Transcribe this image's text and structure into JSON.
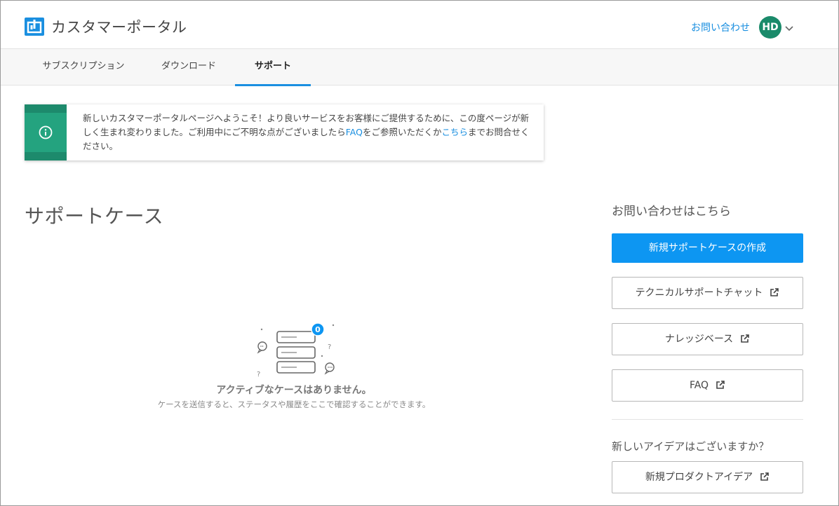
{
  "header": {
    "app_title": "カスタマーポータル",
    "contact_link": "お問い合わせ",
    "avatar_initials": "HD"
  },
  "tabs": [
    {
      "label": "サブスクリプション",
      "active": false
    },
    {
      "label": "ダウンロード",
      "active": false
    },
    {
      "label": "サポート",
      "active": true
    }
  ],
  "notice": {
    "text_before": "新しいカスタマーポータルページへようこそ！より良いサービスをお客様にご提供するために、この度ページが新しく生まれ変わりました。ご利用中にご不明な点がございましたら",
    "faq_link": "FAQ",
    "text_middle": "をご参照いただくか",
    "here_link": "こちら",
    "text_after": "までお問合せください。"
  },
  "main": {
    "title": "サポートケース",
    "case_count": "0",
    "empty_title": "アクティブなケースはありません。",
    "empty_subtitle": "ケースを送信すると、ステータスや履歴をここで確認することができます。"
  },
  "sidebar": {
    "title": "お問い合わせはこちら",
    "primary_button": "新規サポートケースの作成",
    "buttons": [
      {
        "label": "テクニカルサポートチャット"
      },
      {
        "label": "ナレッジベース"
      },
      {
        "label": "FAQ"
      }
    ],
    "idea_title": "新しいアイデアはございますか？",
    "idea_button": "新規プロダクトアイデア"
  },
  "colors": {
    "accent": "#1a8fe0",
    "primary_button": "#0d96f2",
    "notice_green": "#24a37f",
    "avatar": "#1a8a6a"
  },
  "icons": [
    "logo-icon",
    "chevron-down-icon",
    "info-icon",
    "external-link-icon",
    "chat-bubble-icon",
    "question-icon"
  ]
}
